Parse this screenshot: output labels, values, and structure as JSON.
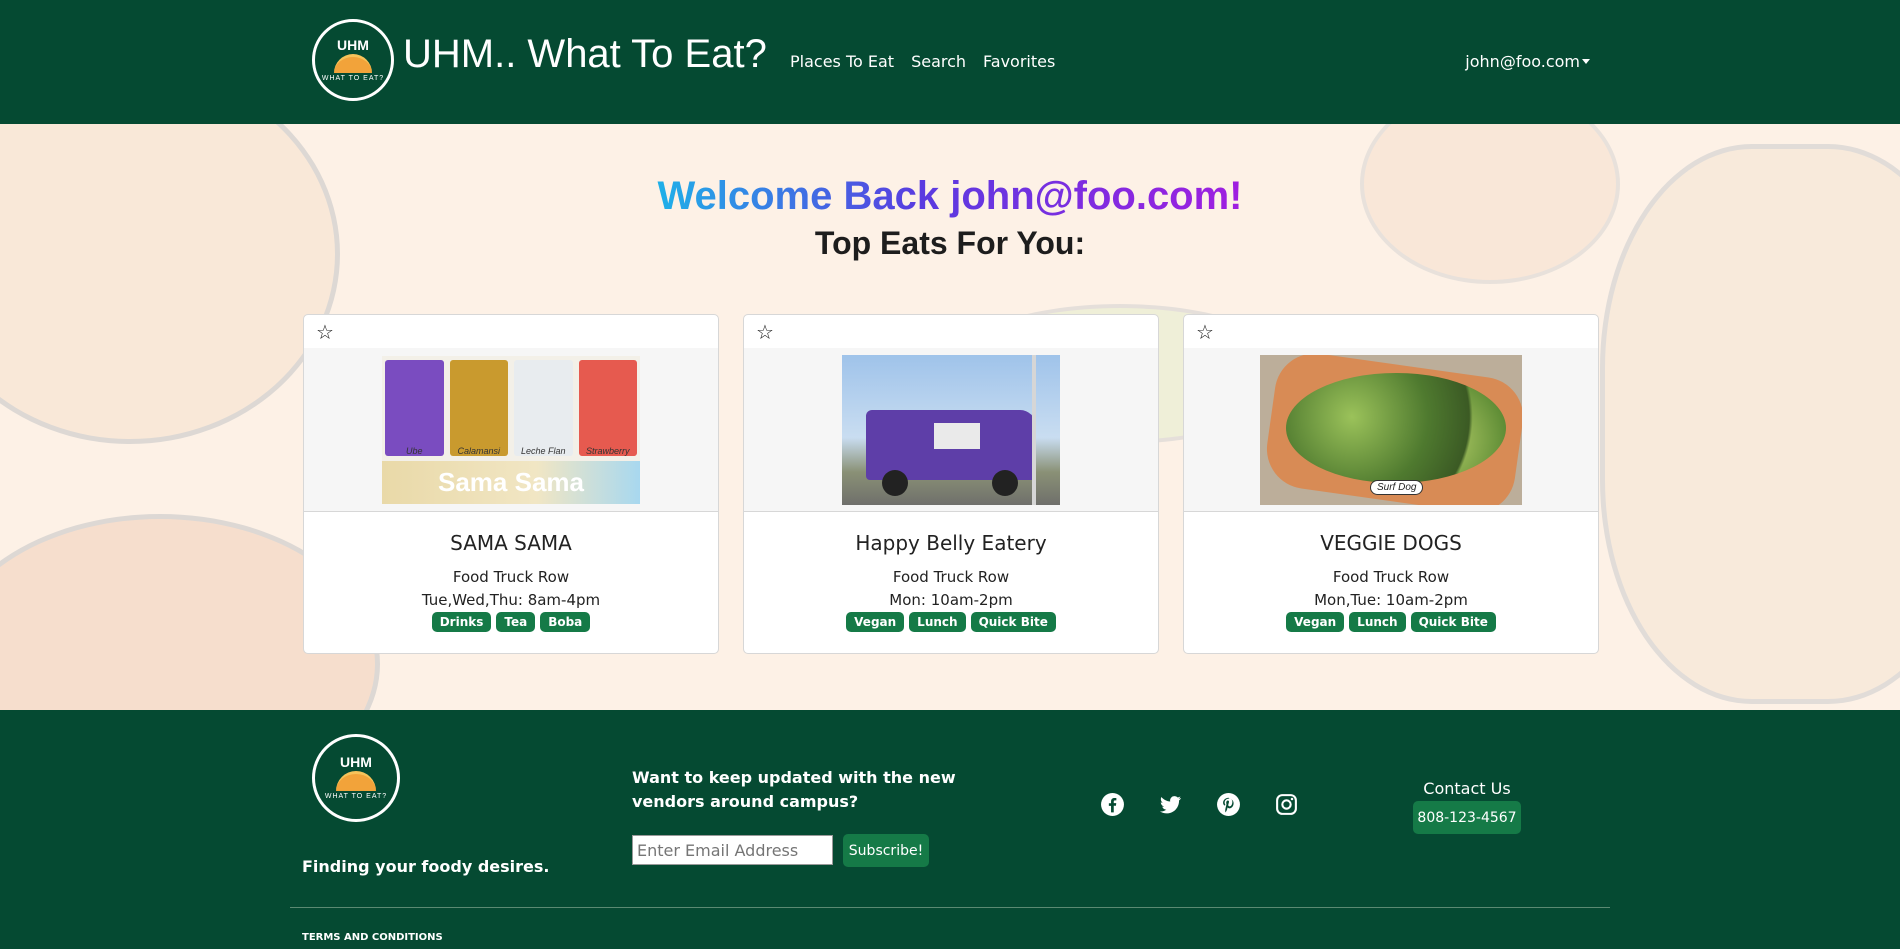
{
  "navbar": {
    "logo_top": "UHM",
    "logo_bottom": "WHAT TO EAT?",
    "brand": "UHM.. What To Eat?",
    "links": [
      "Places To Eat",
      "Search",
      "Favorites"
    ],
    "user": "john@foo.com"
  },
  "hero": {
    "welcome": "Welcome Back john@foo.com!",
    "subtitle": "Top Eats For You:"
  },
  "cards": [
    {
      "title": "SAMA SAMA",
      "location": "Food Truck Row",
      "hours": "Tue,Wed,Thu: 8am-4pm",
      "tags": [
        "Drinks",
        "Tea",
        "Boba"
      ],
      "image_labels": [
        "Ube",
        "Calamansi",
        "Leche Flan",
        "Strawberry"
      ],
      "image_logo": "Sama Sama"
    },
    {
      "title": "Happy Belly Eatery",
      "location": "Food Truck Row",
      "hours": "Mon: 10am-2pm",
      "tags": [
        "Vegan",
        "Lunch",
        "Quick Bite"
      ]
    },
    {
      "title": "VEGGIE DOGS",
      "location": "Food Truck Row",
      "hours": "Mon,Tue: 10am-2pm",
      "tags": [
        "Vegan",
        "Lunch",
        "Quick Bite"
      ],
      "image_tag": "Surf Dog"
    }
  ],
  "footer": {
    "tagline": "Finding your foody desires.",
    "newsletter_text": "Want to keep updated with the new vendors around campus?",
    "email_placeholder": "Enter Email Address",
    "subscribe_label": "Subscribe!",
    "contact_label": "Contact Us",
    "phone": "808-123-4567",
    "terms": "TERMS AND CONDITIONS",
    "socials": [
      "facebook-icon",
      "twitter-icon",
      "pinterest-icon",
      "instagram-icon"
    ]
  },
  "colors": {
    "primary": "#054a32",
    "badge": "#157a47",
    "gradient_start": "#1fb0e8",
    "gradient_end": "#a01ee0"
  }
}
